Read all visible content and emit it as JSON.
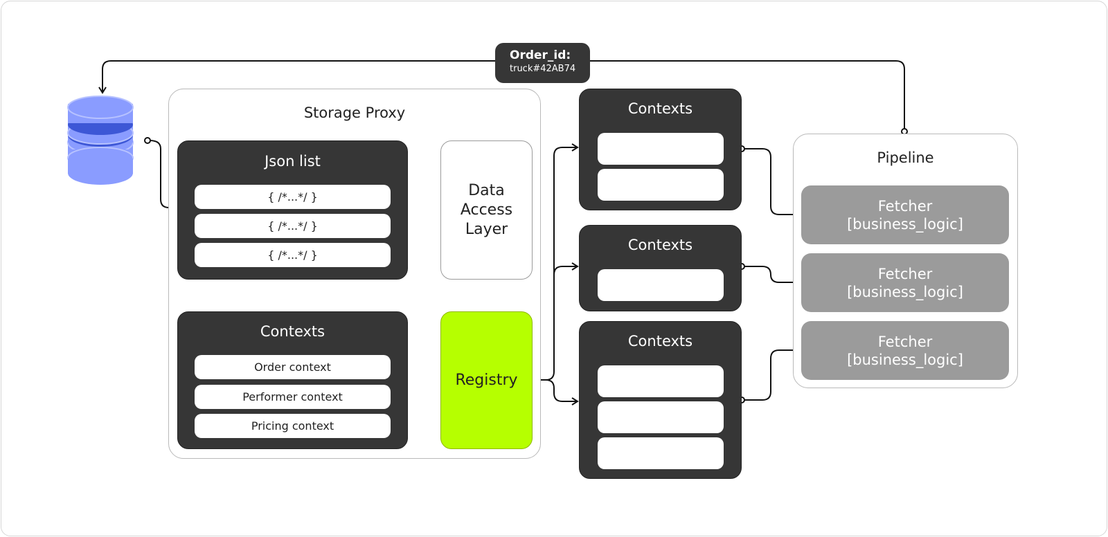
{
  "order_badge": {
    "label": "Order_id:",
    "value": "truck#42AB74"
  },
  "storage_proxy": {
    "title": "Storage Proxy",
    "json_list": {
      "title": "Json list",
      "items": [
        "{ /*...*/ }",
        "{ /*...*/ }",
        "{ /*...*/ }"
      ]
    },
    "data_access_layer": {
      "title": "Data Access Layer"
    },
    "contexts": {
      "title": "Contexts",
      "items": [
        "Order context",
        "Performer context",
        "Pricing context"
      ]
    },
    "registry": {
      "title": "Registry",
      "color": "#b6ff00"
    }
  },
  "context_groups": [
    {
      "title": "Contexts"
    },
    {
      "title": "Contexts"
    },
    {
      "title": "Contexts"
    }
  ],
  "pipeline": {
    "title": "Pipeline",
    "fetchers": [
      {
        "name": "Fetcher",
        "detail": "[business_logic]"
      },
      {
        "name": "Fetcher",
        "detail": "[business_logic]"
      },
      {
        "name": "Fetcher",
        "detail": "[business_logic]"
      }
    ]
  },
  "colors": {
    "database": "#8a9cff",
    "database_dark": "#3d57d6",
    "dark_box": "#363636",
    "fetcher": "#9b9b9b"
  }
}
